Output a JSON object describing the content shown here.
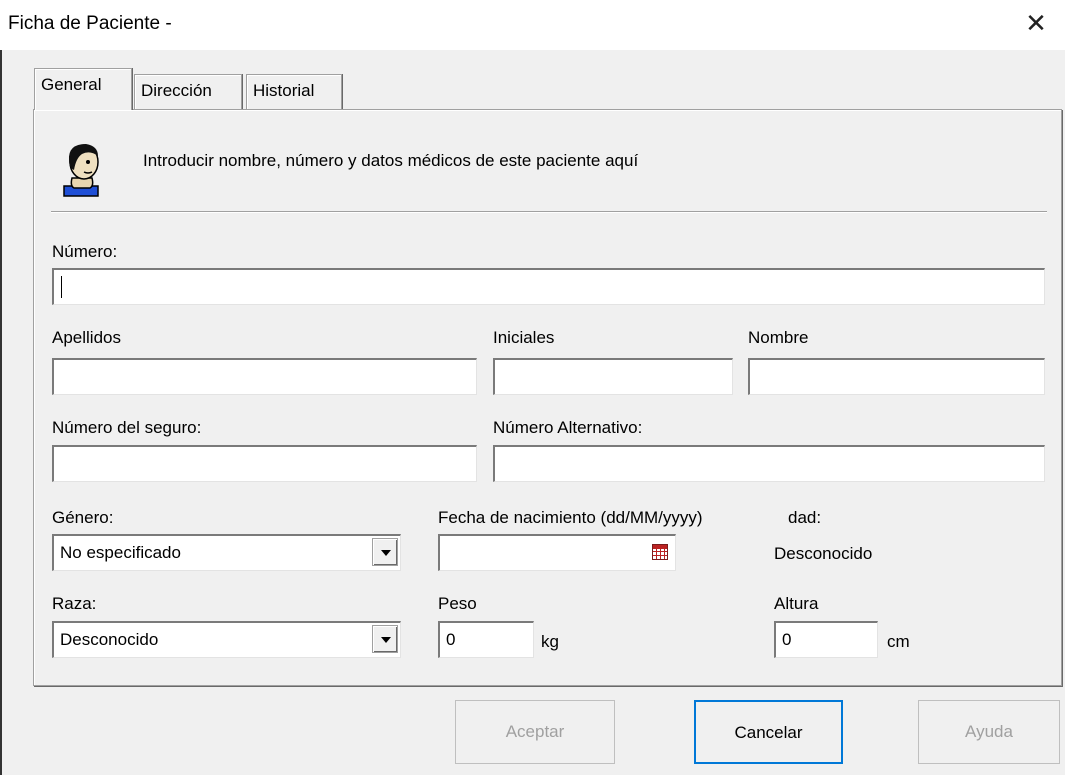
{
  "window": {
    "title": "Ficha de Paciente -",
    "close_label": "✕"
  },
  "tabs": [
    {
      "label": "General",
      "active": true
    },
    {
      "label": "Dirección",
      "active": false
    },
    {
      "label": "Historial",
      "active": false
    }
  ],
  "intro": {
    "text": "Introducir nombre, número y datos médicos de este paciente aquí",
    "icon": "patient-icon"
  },
  "form": {
    "numero_label": "Número:",
    "numero_value": "",
    "apellidos_label": "Apellidos",
    "apellidos_value": "",
    "iniciales_label": "Iniciales",
    "iniciales_value": "",
    "nombre_label": "Nombre",
    "nombre_value": "",
    "seguro_label": "Número del seguro:",
    "seguro_value": "",
    "alternativo_label": "Número Alternativo:",
    "alternativo_value": "",
    "genero_label": "Género:",
    "genero_value": "No especificado",
    "fecha_label": "Fecha de nacimiento  (dd/MM/yyyy)",
    "fecha_value": "",
    "edad_label": "dad:",
    "edad_value": "Desconocido",
    "raza_label": "Raza:",
    "raza_value": "Desconocido",
    "peso_label": "Peso",
    "peso_value": "0",
    "peso_unit": "kg",
    "altura_label": "Altura",
    "altura_value": "0",
    "altura_unit": "cm"
  },
  "buttons": {
    "aceptar": "Aceptar",
    "cancelar": "Cancelar",
    "ayuda": "Ayuda"
  }
}
